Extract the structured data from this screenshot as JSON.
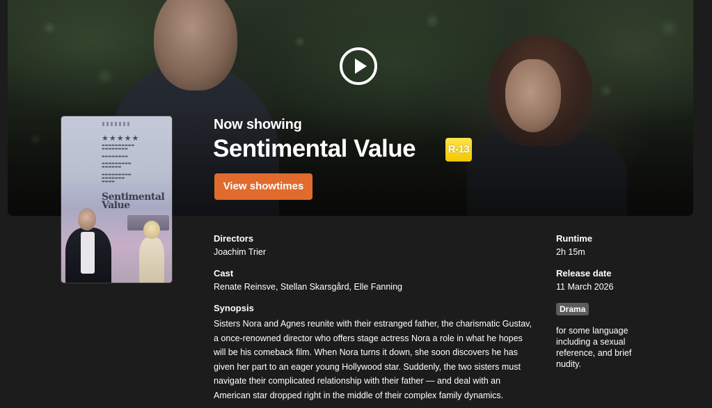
{
  "hero": {
    "eyebrow": "Now showing",
    "title": "Sentimental Value",
    "rating": "R-13",
    "cta_label": "View showtimes",
    "play_icon": "play-circle-icon"
  },
  "poster": {
    "stars": "★★★★★",
    "title_line1": "Sentimental",
    "title_line2": "Value"
  },
  "details": {
    "directors_label": "Directors",
    "directors": "Joachim Trier",
    "cast_label": "Cast",
    "cast": "Renate Reinsve, Stellan Skarsgård, Elle Fanning",
    "synopsis_label": "Synopsis",
    "synopsis": "Sisters Nora and Agnes reunite with their estranged father, the charismatic Gustav, a once-renowned director who offers stage actress Nora a role in what he hopes will be his comeback film. When Nora turns it down, she soon discovers he has given her part to an eager young Hollywood star. Suddenly, the two sisters must navigate their complicated relationship with their father — and deal with an American star dropped right in the middle of their complex family dynamics.",
    "runtime_label": "Runtime",
    "runtime": "2h 15m",
    "release_label": "Release date",
    "release": "11 March 2026",
    "genre": "Drama",
    "rating_note": "for some language including a sexual reference, and brief nudity."
  },
  "colors": {
    "background": "#1c1c1c",
    "cta": "#e06b2d",
    "rating_badge": "#f5cf12",
    "genre_tag": "#5c5c5c"
  }
}
